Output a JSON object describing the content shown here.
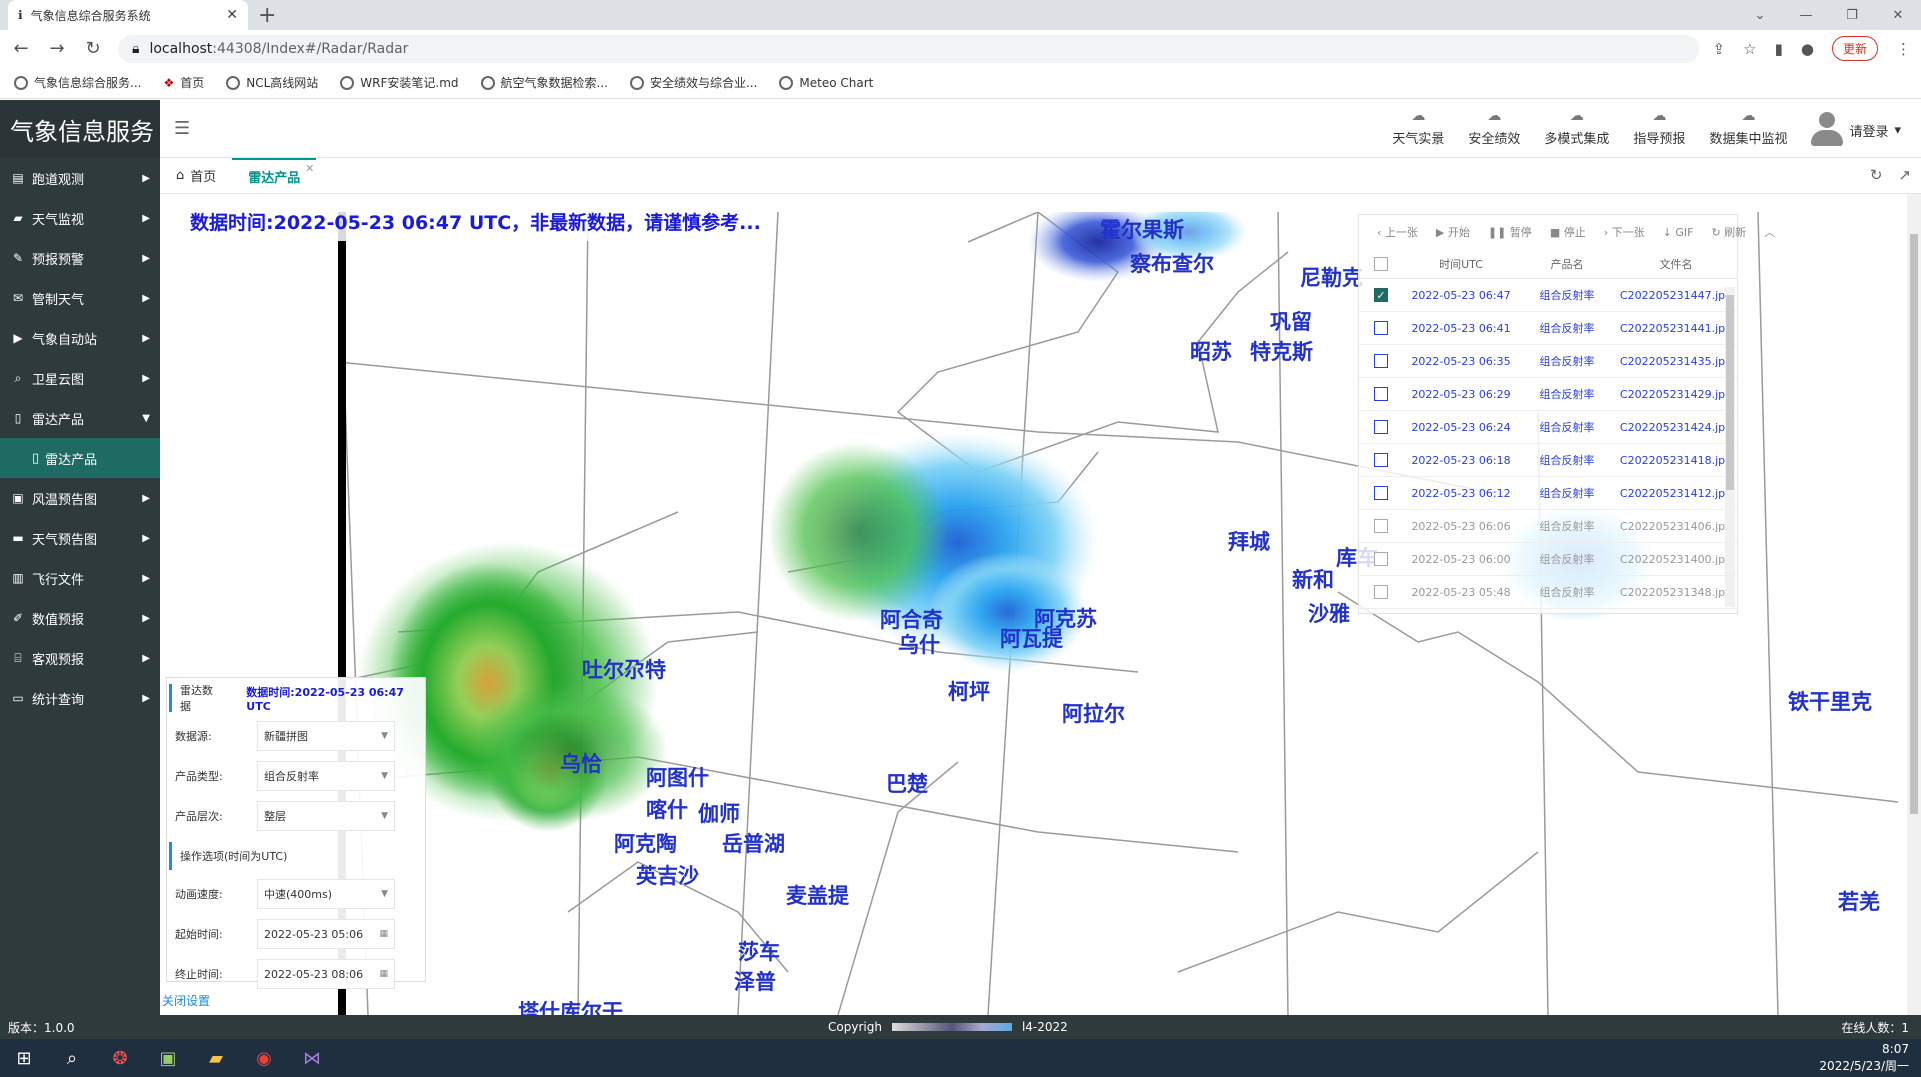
{
  "browser": {
    "tab_title": "气象信息综合服务系统",
    "url_host": "localhost",
    "url_rest": ":44308/Index#/Radar/Radar",
    "update_label": "更新",
    "bookmarks": [
      "气象信息综合服务...",
      "首页",
      "NCL高线网站",
      "WRF安装笔记.md",
      "航空气象数据检索...",
      "安全绩效与综合业...",
      "Meteo Chart"
    ]
  },
  "app": {
    "logo": "气象信息服务",
    "sidebar": [
      {
        "label": "跑道观测",
        "icon": "table-icon"
      },
      {
        "label": "天气监视",
        "icon": "book-icon"
      },
      {
        "label": "预报预警",
        "icon": "edit-icon"
      },
      {
        "label": "管制天气",
        "icon": "mail-icon"
      },
      {
        "label": "气象自动站",
        "icon": "camera-icon"
      },
      {
        "label": "卫星云图",
        "icon": "search-icon"
      },
      {
        "label": "雷达产品",
        "icon": "file-icon"
      },
      {
        "label": "风温预告图",
        "icon": "image-icon"
      },
      {
        "label": "天气预告图",
        "icon": "folder-icon"
      },
      {
        "label": "飞行文件",
        "icon": "chart-icon"
      },
      {
        "label": "数值预报",
        "icon": "pen-icon"
      },
      {
        "label": "客观预报",
        "icon": "folder-open-icon"
      },
      {
        "label": "统计查询",
        "icon": "monitor-icon"
      }
    ],
    "submenu_active": "雷达产品",
    "topnav": [
      "天气实景",
      "安全绩效",
      "多模式集成",
      "指导预报",
      "数据集中监视"
    ],
    "login": "请登录",
    "tabs": [
      {
        "label": "首页"
      },
      {
        "label": "雷达产品"
      }
    ]
  },
  "content": {
    "banner": "数据时间:2022-05-23 06:47 UTC，非最新数据，请谨慎参考...",
    "file_panel": {
      "toolbar": [
        "上一张",
        "开始",
        "暂停",
        "停止",
        "下一张",
        "GIF",
        "刷新"
      ],
      "headers": [
        "时间UTC",
        "产品名",
        "文件名"
      ],
      "rows": [
        {
          "time": "2022-05-23 06:47",
          "product": "组合反射率",
          "file": "C202205231447.jpg",
          "checked": true,
          "enabled": true
        },
        {
          "time": "2022-05-23 06:41",
          "product": "组合反射率",
          "file": "C202205231441.jpg",
          "checked": false,
          "enabled": true
        },
        {
          "time": "2022-05-23 06:35",
          "product": "组合反射率",
          "file": "C202205231435.jpg",
          "checked": false,
          "enabled": true
        },
        {
          "time": "2022-05-23 06:29",
          "product": "组合反射率",
          "file": "C202205231429.jpg",
          "checked": false,
          "enabled": true
        },
        {
          "time": "2022-05-23 06:24",
          "product": "组合反射率",
          "file": "C202205231424.jpg",
          "checked": false,
          "enabled": true
        },
        {
          "time": "2022-05-23 06:18",
          "product": "组合反射率",
          "file": "C202205231418.jpg",
          "checked": false,
          "enabled": true
        },
        {
          "time": "2022-05-23 06:12",
          "product": "组合反射率",
          "file": "C202205231412.jpg",
          "checked": false,
          "enabled": true
        },
        {
          "time": "2022-05-23 06:06",
          "product": "组合反射率",
          "file": "C202205231406.jpg",
          "checked": false,
          "enabled": false
        },
        {
          "time": "2022-05-23 06:00",
          "product": "组合反射率",
          "file": "C202205231400.jpg",
          "checked": false,
          "enabled": false
        },
        {
          "time": "2022-05-23 05:48",
          "product": "组合反射率",
          "file": "C202205231348.jpg",
          "checked": false,
          "enabled": false
        }
      ]
    },
    "settings": {
      "title": "雷达数据",
      "data_time": "数据时间:2022-05-23 06:47 UTC",
      "source_label": "数据源:",
      "source_value": "新疆拼图",
      "type_label": "产品类型:",
      "type_value": "组合反射率",
      "level_label": "产品层次:",
      "level_value": "整层",
      "ops_title": "操作选项(时间为UTC)",
      "speed_label": "动画速度:",
      "speed_value": "中速(400ms)",
      "start_label": "起始时间:",
      "start_value": "2022-05-23 05:06",
      "end_label": "终止时间:",
      "end_value": "2022-05-23 08:06",
      "close_label": "关闭设置"
    },
    "cities": [
      "霍尔果斯",
      "察布查尔",
      "尼勒克",
      "巩留",
      "昭苏",
      "特克斯",
      "拜城",
      "库车",
      "新和",
      "沙雅",
      "阿合奇",
      "乌什",
      "阿瓦提",
      "阿克苏",
      "柯坪",
      "阿拉尔",
      "巴楚",
      "吐尔尕特",
      "乌恰",
      "阿图什",
      "喀什",
      "伽师",
      "阿克陶",
      "岳普湖",
      "英吉沙",
      "麦盖提",
      "莎车",
      "泽普",
      "塔什库尔干",
      "铁干里克",
      "若羌"
    ]
  },
  "footer": {
    "version": "版本：1.0.0",
    "copyright_left": "Copyrigh",
    "copyright_right": "l4-2022",
    "online": "在线人数：1"
  },
  "taskbar": {
    "time": "8:07",
    "date": "2022/5/23/周一"
  }
}
